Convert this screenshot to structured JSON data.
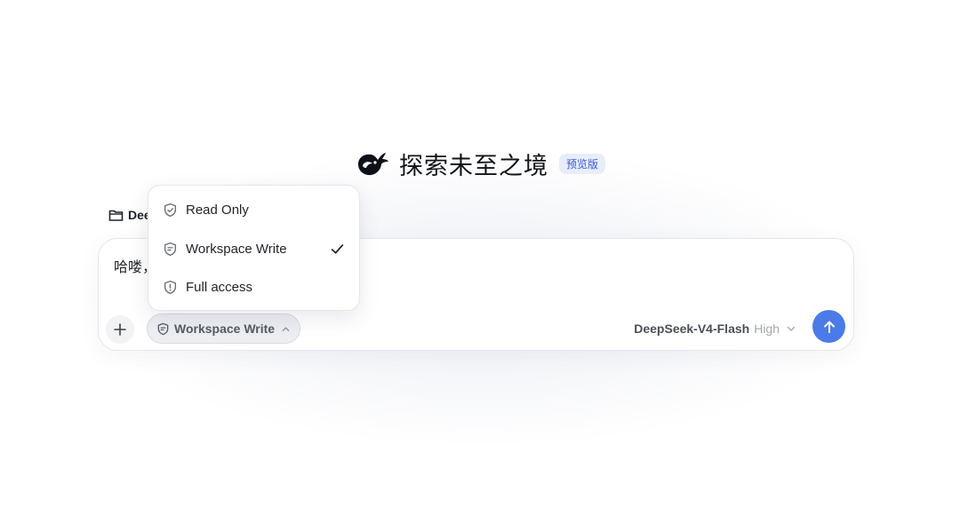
{
  "hero": {
    "title": "探索未至之境",
    "badge": "预览版"
  },
  "workspace": {
    "folder_label": "Dee"
  },
  "composer": {
    "prompt_text": "哈喽，",
    "permission_button_label": "Workspace Write",
    "model_name": "DeepSeek-V4-Flash",
    "model_level": "High"
  },
  "permission_menu": {
    "items": [
      {
        "label": "Read Only",
        "icon": "shield-check-icon",
        "selected": false
      },
      {
        "label": "Workspace Write",
        "icon": "shield-edit-icon",
        "selected": true
      },
      {
        "label": "Full access",
        "icon": "shield-alert-icon",
        "selected": false
      }
    ]
  },
  "colors": {
    "accent": "#4b7be8",
    "badge_bg": "#e8edfb",
    "badge_text": "#3b5bd6"
  }
}
